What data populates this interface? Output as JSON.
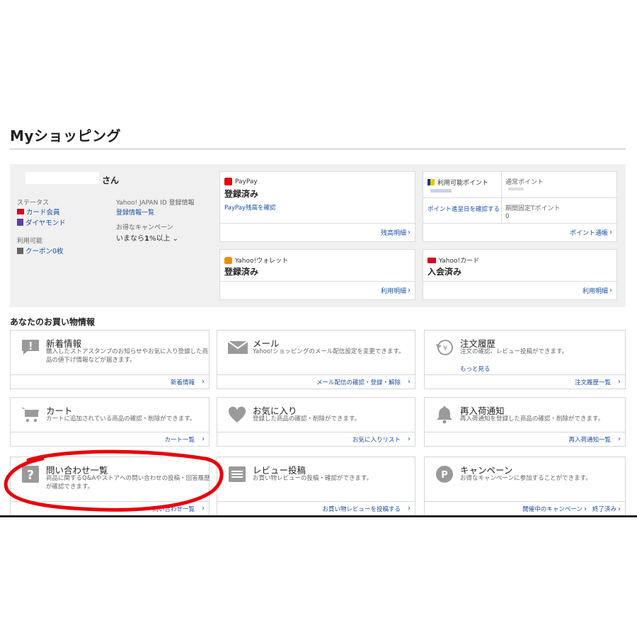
{
  "page_title": "Myショッピング",
  "account": {
    "san": "さん",
    "status_label": "ステータス",
    "card_member": "カード会員",
    "diamond": "ダイヤモンド",
    "available_label": "利用可能",
    "coupon": "クーポン0枚",
    "yid_label": "Yahoo! JAPAN ID 登録情報",
    "reg_list": "登録情報一覧",
    "campaign_label": "お得なキャンペーン",
    "campaign_value_prefix": "いまなら",
    "campaign_value_num": "1",
    "campaign_value_suffix": "%以上"
  },
  "paypay": {
    "brand": "PayPay",
    "status": "登録済み",
    "link": "PayPay残高を確認",
    "foot": "残高明細"
  },
  "points": {
    "available": "利用可能ポイント",
    "normal": "通常ポイント",
    "expiry_link": "ポイント進呈日を確認する",
    "limited": "期間固定Tポイント",
    "limited_value": "0",
    "foot": "ポイント通帳"
  },
  "wallet": {
    "brand": "Yahoo!ウォレット",
    "status": "登録済み",
    "foot": "利用明細"
  },
  "ycard": {
    "brand": "Yahoo!カード",
    "status": "入会済み",
    "foot": "利用明細"
  },
  "section_title": "あなたのお買い物情報",
  "cards": [
    {
      "title": "新着情報",
      "desc": "購入したストアスタンプのお知らせやお気に入り登録した商品の値下げ情報などが届きます。",
      "foot": "新着情報"
    },
    {
      "title": "メール",
      "desc": "Yahoo!ショッピングのメール配信設定を変更できます。",
      "foot": "メール配信の確認・登録・解除"
    },
    {
      "title": "注文履歴",
      "desc": "注文の確認、レビュー投稿ができます。",
      "more": "もっと見る",
      "foot": "注文履歴一覧"
    },
    {
      "title": "カート",
      "desc": "カートに追加されている商品の確認・削除ができます。",
      "foot": "カート一覧"
    },
    {
      "title": "お気に入り",
      "desc": "登録した商品の確認・削除ができます。",
      "foot": "お気に入りリスト"
    },
    {
      "title": "再入荷通知",
      "desc": "再入荷通知を登録した商品の確認・削除ができます。",
      "foot": "再入荷通知一覧"
    },
    {
      "title": "問い合わせ一覧",
      "desc": "商品に関するQ&Aやストアへの問い合わせの投稿・回答履歴が確認できます。",
      "foot": "問い合わせ一覧"
    },
    {
      "title": "レビュー投稿",
      "desc": "お買い物レビューの投稿・確認ができます。",
      "foot": "お買い物レビューを投稿する"
    },
    {
      "title": "キャンペーン",
      "desc": "お得なキャンペーンに参加することができます。",
      "foot": "開催中のキャンペーン",
      "foot2": "終了済み"
    }
  ],
  "colors": {
    "link": "#1a4fa3",
    "panel_bg": "#f0f0f0",
    "annotation_red": "#e8000b",
    "icon_gray": "#9a9a9a"
  }
}
